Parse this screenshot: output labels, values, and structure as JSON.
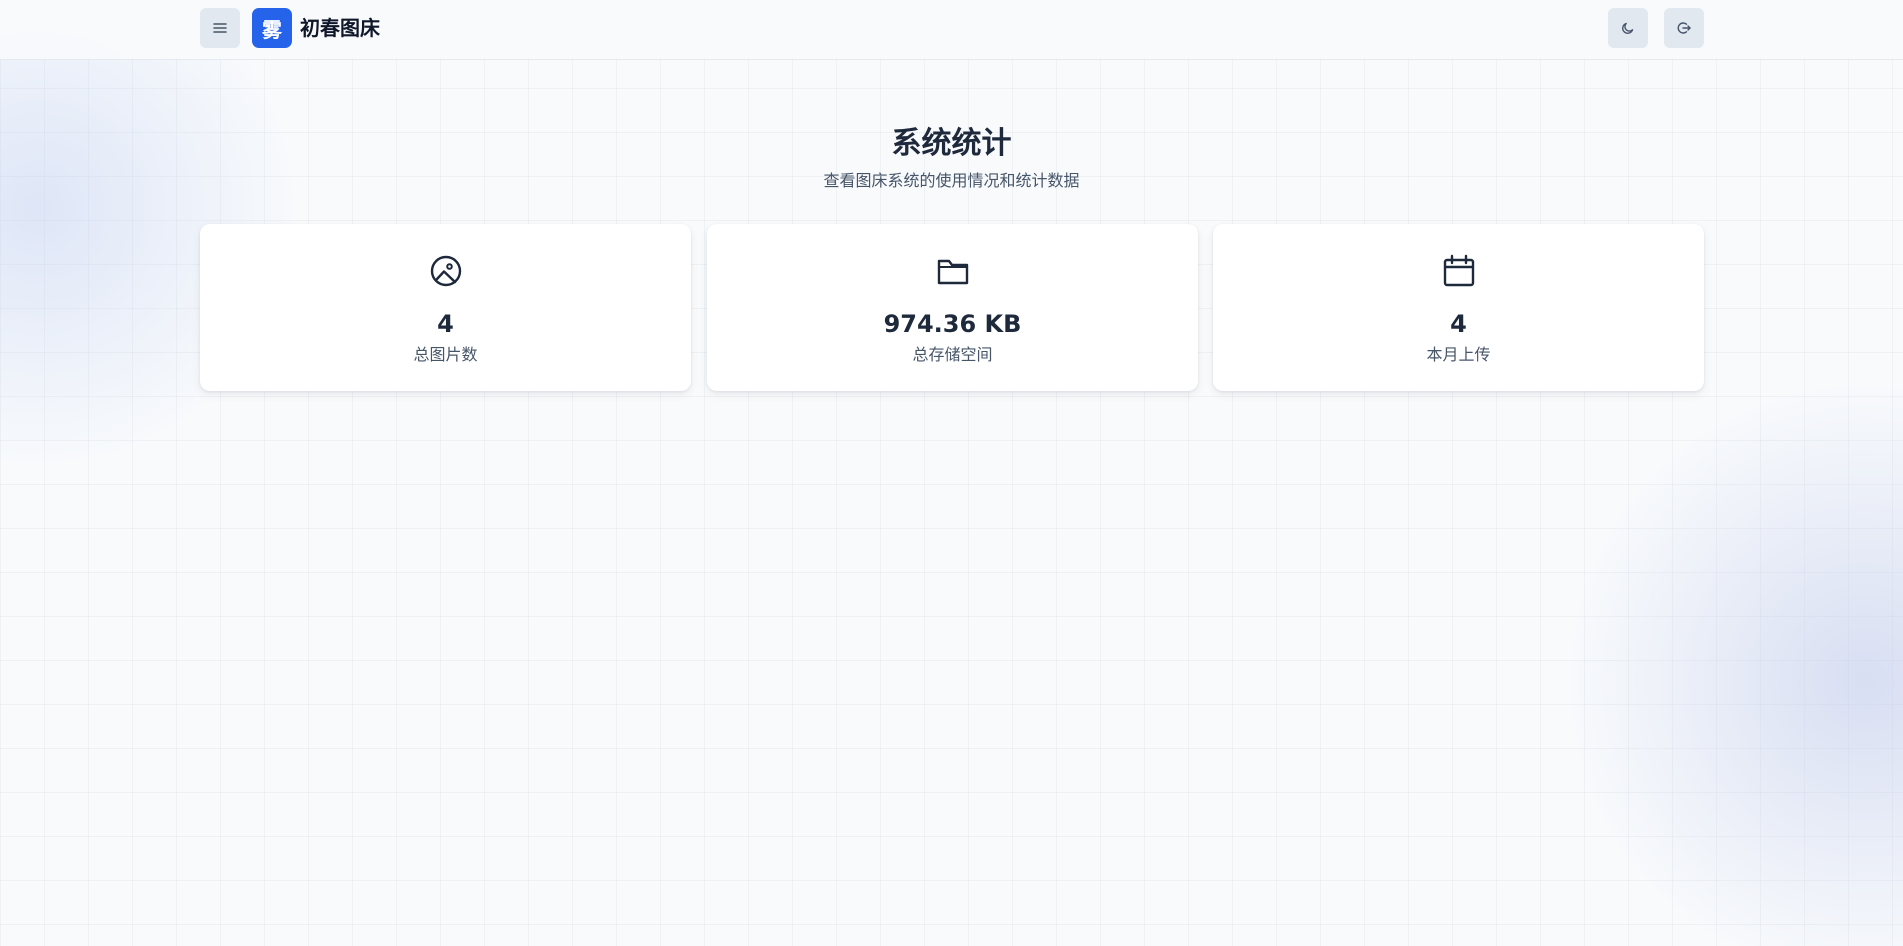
{
  "header": {
    "menu_icon": "menu-icon",
    "logo_text": "雾",
    "brand": "初春图床",
    "theme_icon": "moon-icon",
    "logout_icon": "logout-icon"
  },
  "main": {
    "title": "系统统计",
    "subtitle": "查看图床系统的使用情况和统计数据",
    "stats": [
      {
        "icon": "image-icon",
        "value": "4",
        "label": "总图片数"
      },
      {
        "icon": "folder-icon",
        "value": "974.36 KB",
        "label": "总存储空间"
      },
      {
        "icon": "calendar-icon",
        "value": "4",
        "label": "本月上传"
      }
    ]
  },
  "colors": {
    "accent": "#2563eb",
    "background": "#f8fafc",
    "text": "#1e293b",
    "muted_text": "#475569"
  }
}
